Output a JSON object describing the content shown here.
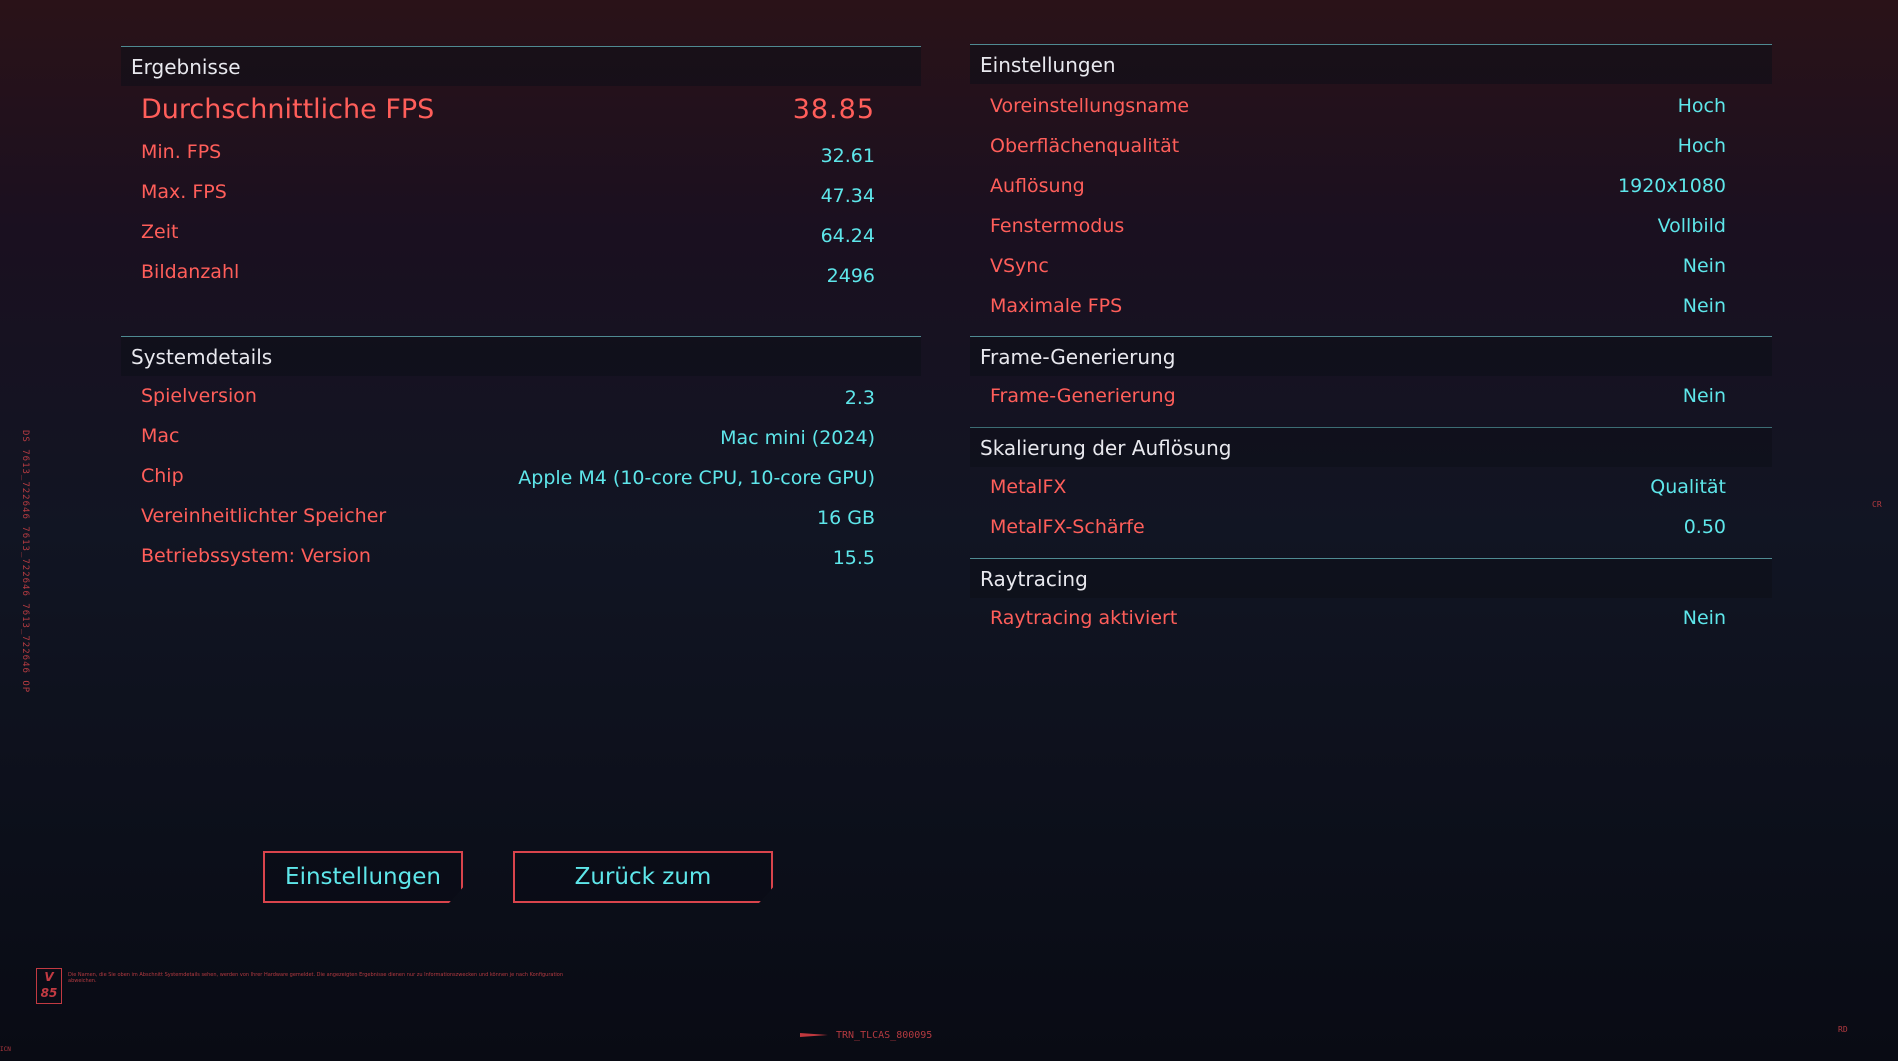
{
  "results": {
    "title": "Ergebnisse",
    "avg": {
      "label": "Durchschnittliche FPS",
      "value": "38.85"
    },
    "rows": [
      {
        "label": "Min. FPS",
        "value": "32.61"
      },
      {
        "label": "Max. FPS",
        "value": "47.34"
      },
      {
        "label": "Zeit",
        "value": "64.24"
      },
      {
        "label": "Bildanzahl",
        "value": "2496"
      }
    ]
  },
  "system": {
    "title": "Systemdetails",
    "rows": [
      {
        "label": "Spielversion",
        "value": "2.3"
      },
      {
        "label": "Mac",
        "value": "Mac mini (2024)"
      },
      {
        "label": "Chip",
        "value": "Apple M4 (10-core CPU, 10-core GPU)"
      },
      {
        "label": "Vereinheitlichter Speicher",
        "value": "16 GB"
      },
      {
        "label": "Betriebssystem: Version",
        "value": "15.5"
      }
    ]
  },
  "settings": {
    "title": "Einstellungen",
    "rows": [
      {
        "label": "Voreinstellungsname",
        "value": "Hoch"
      },
      {
        "label": "Oberflächenqualität",
        "value": "Hoch"
      },
      {
        "label": "Auflösung",
        "value": "1920x1080"
      },
      {
        "label": "Fenstermodus",
        "value": "Vollbild"
      },
      {
        "label": "VSync",
        "value": "Nein"
      },
      {
        "label": "Maximale FPS",
        "value": "Nein"
      }
    ]
  },
  "framegen": {
    "title": "Frame-Generierung",
    "rows": [
      {
        "label": "Frame-Generierung",
        "value": "Nein"
      }
    ]
  },
  "scaling": {
    "title": "Skalierung der Auflösung",
    "rows": [
      {
        "label": "MetalFX",
        "value": "Qualität"
      },
      {
        "label": "MetalFX-Schärfe",
        "value": "0.50"
      }
    ]
  },
  "raytracing": {
    "title": "Raytracing",
    "rows": [
      {
        "label": "Raytracing aktiviert",
        "value": "Nein"
      }
    ]
  },
  "buttons": {
    "settings": "Einstellungen",
    "back": "Zurück zum Hauptmenü"
  },
  "footer": {
    "code": "TRN_TLCAS_800095",
    "logo": "V 85",
    "side_text": "DS 7613_722646 7613_722646 7613_722646 OP",
    "right_tag_1": "CR",
    "right_tag_2": "RD",
    "corner_left": "ICN",
    "disclaimer": "Die Namen, die Sie oben im Abschnitt Systemdetails sehen, werden von Ihrer Hardware gemeldet. Die angezeigten Ergebnisse dienen nur zu Informationszwecken und können je nach Konfiguration abweichen."
  },
  "colors": {
    "accent_red": "#ff5e5a",
    "accent_cyan": "#5ee6ea",
    "divider": "#4f8a92"
  }
}
